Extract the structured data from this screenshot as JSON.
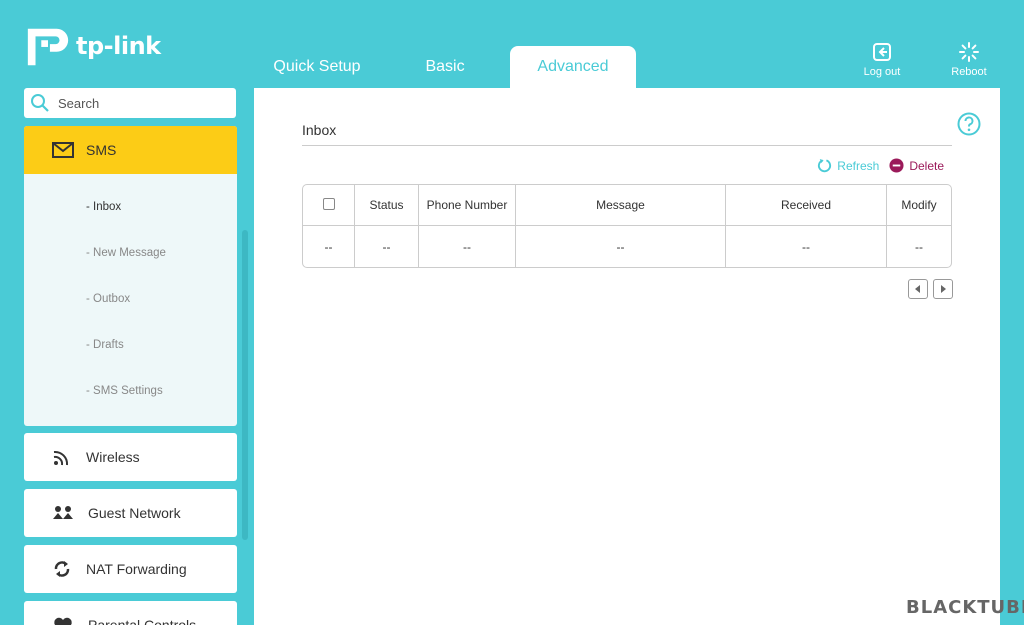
{
  "brand": {
    "name": "tp-link"
  },
  "tabs": [
    {
      "label": "Quick Setup"
    },
    {
      "label": "Basic"
    },
    {
      "label": "Advanced"
    }
  ],
  "top_actions": {
    "logout": "Log out",
    "reboot": "Reboot"
  },
  "sidebar": {
    "search_placeholder": "Search",
    "sms": {
      "label": "SMS",
      "items": [
        "- Inbox",
        "- New Message",
        "- Outbox",
        "- Drafts",
        "- SMS Settings"
      ]
    },
    "menu": [
      {
        "label": "Wireless",
        "icon": "wireless-icon"
      },
      {
        "label": "Guest Network",
        "icon": "guest-network-icon"
      },
      {
        "label": "NAT Forwarding",
        "icon": "nat-forwarding-icon"
      },
      {
        "label": "Parental Controls",
        "icon": "parental-controls-icon"
      }
    ]
  },
  "main": {
    "title": "Inbox",
    "refresh_label": "Refresh",
    "delete_label": "Delete",
    "table": {
      "headers": [
        "Status",
        "Phone Number",
        "Message",
        "Received",
        "Modify"
      ],
      "rows": [
        [
          "--",
          "--",
          "--",
          "--",
          "--",
          "--"
        ]
      ]
    }
  },
  "watermark": "BLACKTUBI",
  "colors": {
    "accent": "#4acbd6",
    "active_menu": "#fccc16",
    "delete": "#9b1a5a"
  }
}
